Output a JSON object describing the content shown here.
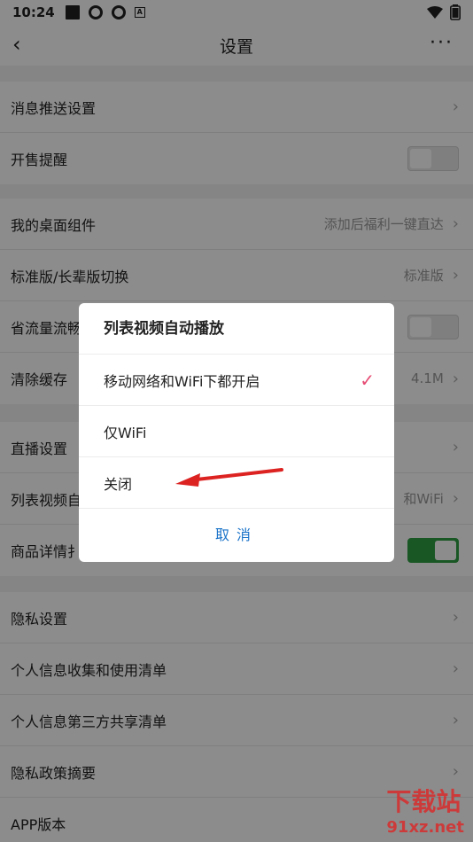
{
  "status": {
    "time": "10:24"
  },
  "header": {
    "title": "设置",
    "back_icon": "‹",
    "more_icon": "···"
  },
  "groups": [
    {
      "items": [
        {
          "label": "消息推送设置",
          "type": "chevron"
        },
        {
          "label": "开售提醒",
          "type": "toggle",
          "on": false
        }
      ]
    },
    {
      "items": [
        {
          "label": "我的桌面组件",
          "value": "添加后福利一键直达",
          "type": "chevron"
        },
        {
          "label": "标准版/长辈版切换",
          "value": "标准版",
          "type": "chevron"
        },
        {
          "label": "省流量流畅",
          "type": "toggle",
          "on": false
        },
        {
          "label": "清除缓存",
          "value": "4.1M",
          "type": "chevron"
        }
      ]
    },
    {
      "items": [
        {
          "label": "直播设置",
          "type": "chevron"
        },
        {
          "label": "列表视频自",
          "value": "和WiFi",
          "type": "chevron"
        },
        {
          "label": "商品详情扌",
          "type": "toggle",
          "on": true
        }
      ]
    },
    {
      "items": [
        {
          "label": "隐私设置",
          "type": "chevron"
        },
        {
          "label": "个人信息收集和使用清单",
          "type": "chevron"
        },
        {
          "label": "个人信息第三方共享清单",
          "type": "chevron"
        },
        {
          "label": "隐私政策摘要",
          "type": "chevron"
        },
        {
          "label": "APP版本",
          "type": "none"
        }
      ]
    }
  ],
  "dialog": {
    "title": "列表视频自动播放",
    "options": [
      "移动网络和WiFi下都开启",
      "仅WiFi",
      "关闭"
    ],
    "cancel": "取消",
    "check": "✓"
  },
  "chevron": "›",
  "watermark": {
    "title": "下载站",
    "site": "91xz.net"
  },
  "colors": {
    "toggle_on": "#2f9e44",
    "accent": "#1a73c9",
    "check": "#e64a73"
  }
}
